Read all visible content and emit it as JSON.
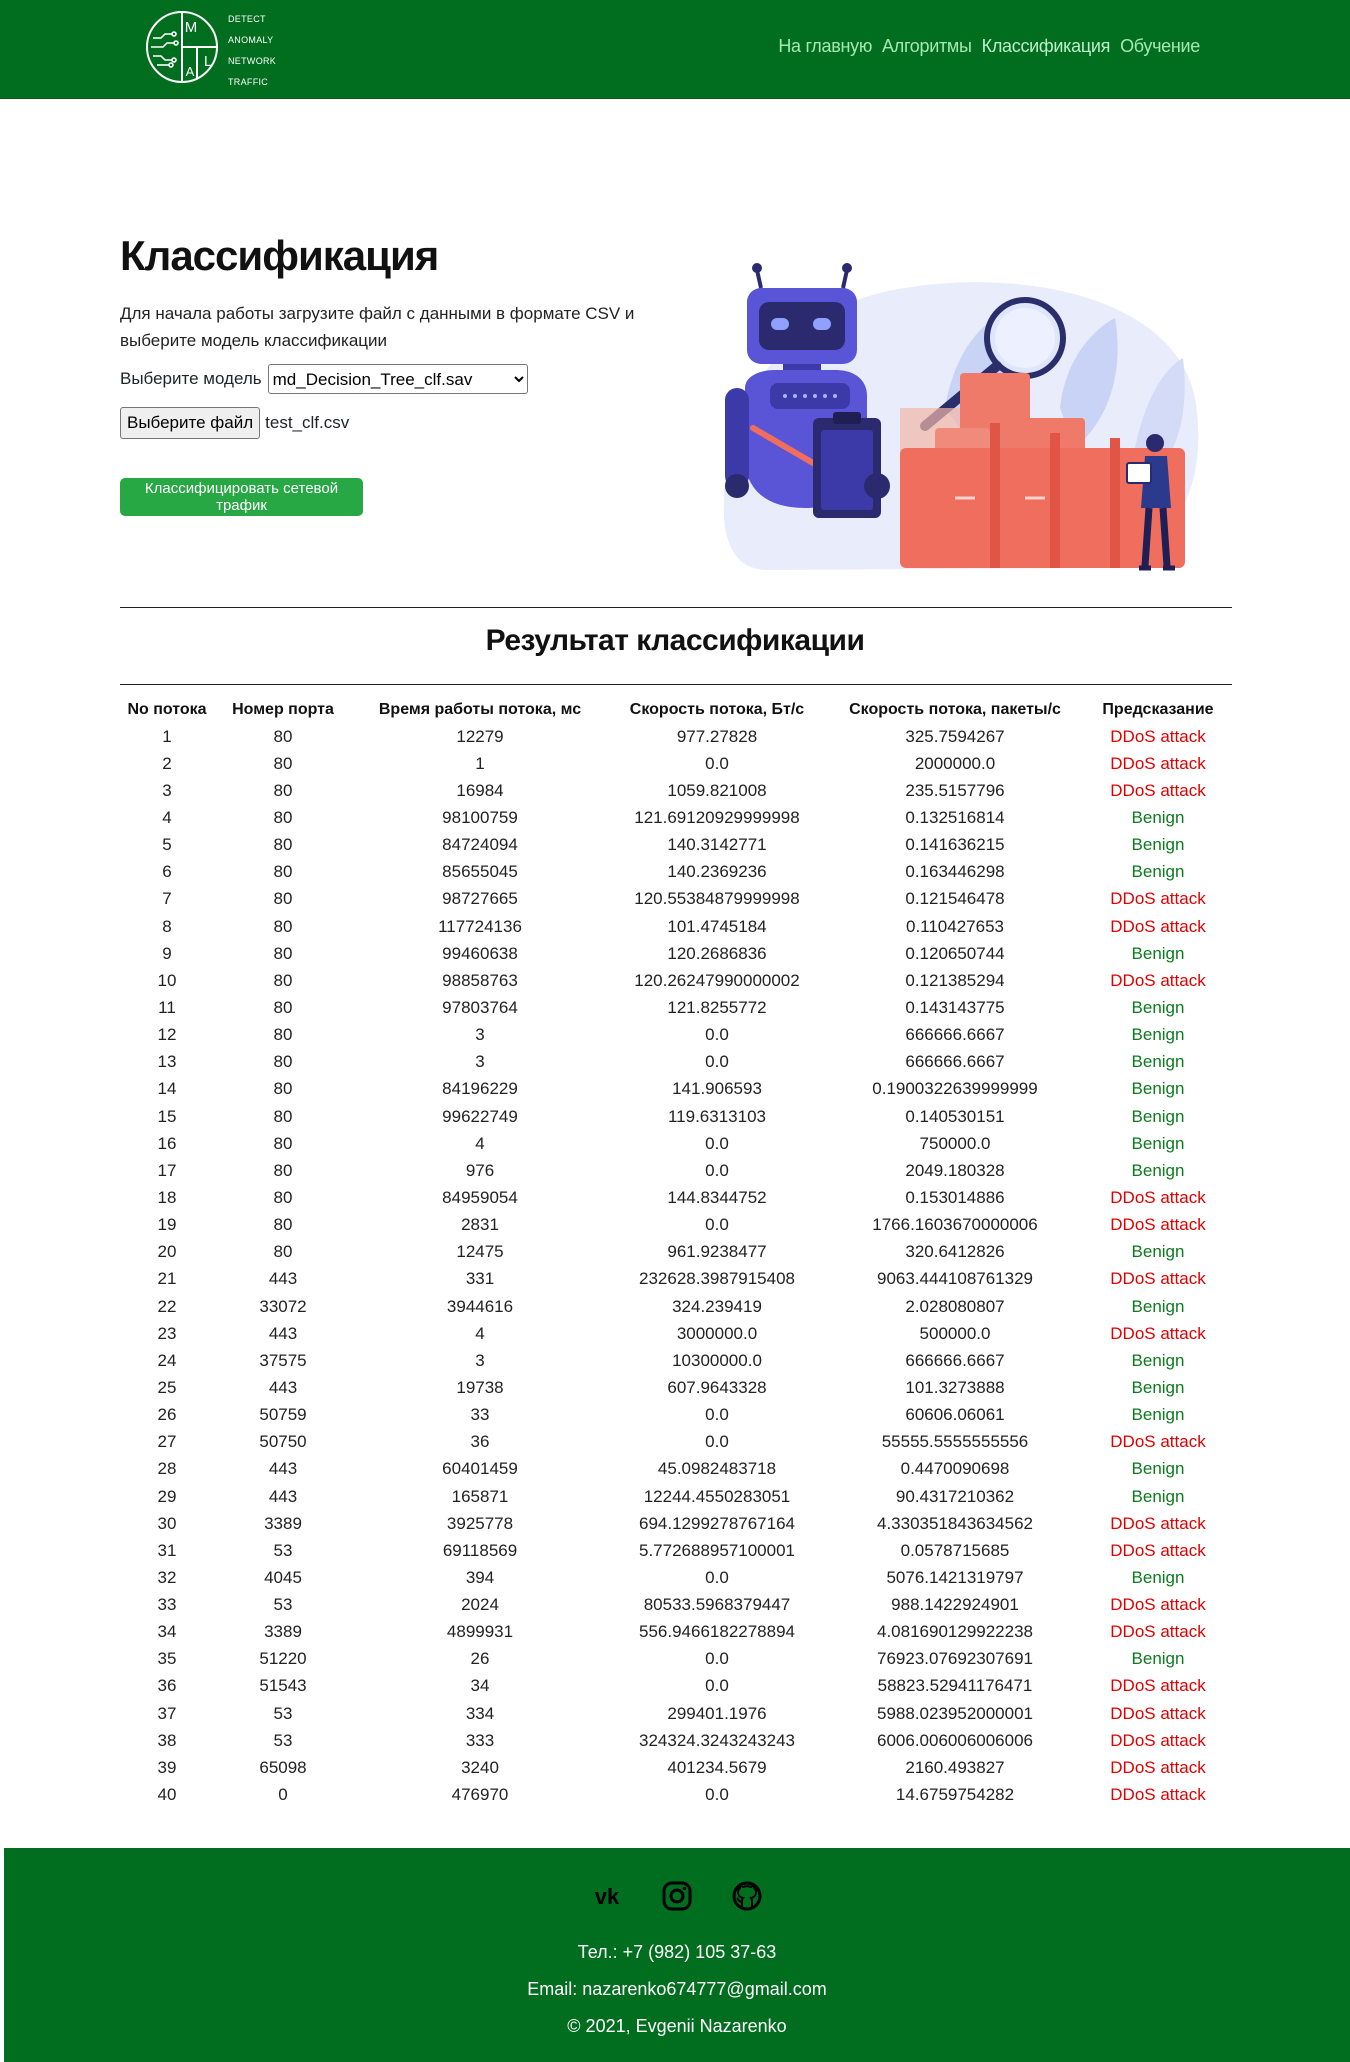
{
  "logo": {
    "letters": [
      "M",
      "L",
      "A"
    ],
    "lines": [
      "DETECT",
      "ANOMALY",
      "NETWORK",
      "TRAFFIC"
    ]
  },
  "nav": [
    {
      "label": "На главную"
    },
    {
      "label": "Алгоритмы"
    },
    {
      "label": "Классификация"
    },
    {
      "label": "Обучение"
    }
  ],
  "page": {
    "title": "Классификация",
    "description": "Для начала работы загрузите файл с данными в формате CSV и выберите модель классификации",
    "model_label": "Выберите модель",
    "model_selected": "md_Decision_Tree_clf.sav",
    "file_button": "Выберите файл",
    "file_name": "test_clf.csv",
    "classify_button": "Классифицировать сетевой трафик"
  },
  "results": {
    "title": "Результат классификации",
    "headers": [
      "No потока",
      "Номер порта",
      "Время работы потока, мс",
      "Скорость потока, Бт/с",
      "Скорость потока, пакеты/с",
      "Предсказание"
    ],
    "rows": [
      [
        "1",
        "80",
        "12279",
        "977.27828",
        "325.7594267",
        "DDoS attack"
      ],
      [
        "2",
        "80",
        "1",
        "0.0",
        "2000000.0",
        "DDoS attack"
      ],
      [
        "3",
        "80",
        "16984",
        "1059.821008",
        "235.5157796",
        "DDoS attack"
      ],
      [
        "4",
        "80",
        "98100759",
        "121.69120929999998",
        "0.132516814",
        "Benign"
      ],
      [
        "5",
        "80",
        "84724094",
        "140.3142771",
        "0.141636215",
        "Benign"
      ],
      [
        "6",
        "80",
        "85655045",
        "140.2369236",
        "0.163446298",
        "Benign"
      ],
      [
        "7",
        "80",
        "98727665",
        "120.55384879999998",
        "0.121546478",
        "DDoS attack"
      ],
      [
        "8",
        "80",
        "117724136",
        "101.4745184",
        "0.110427653",
        "DDoS attack"
      ],
      [
        "9",
        "80",
        "99460638",
        "120.2686836",
        "0.120650744",
        "Benign"
      ],
      [
        "10",
        "80",
        "98858763",
        "120.26247990000002",
        "0.121385294",
        "DDoS attack"
      ],
      [
        "11",
        "80",
        "97803764",
        "121.8255772",
        "0.143143775",
        "Benign"
      ],
      [
        "12",
        "80",
        "3",
        "0.0",
        "666666.6667",
        "Benign"
      ],
      [
        "13",
        "80",
        "3",
        "0.0",
        "666666.6667",
        "Benign"
      ],
      [
        "14",
        "80",
        "84196229",
        "141.906593",
        "0.1900322639999999",
        "Benign"
      ],
      [
        "15",
        "80",
        "99622749",
        "119.6313103",
        "0.140530151",
        "Benign"
      ],
      [
        "16",
        "80",
        "4",
        "0.0",
        "750000.0",
        "Benign"
      ],
      [
        "17",
        "80",
        "976",
        "0.0",
        "2049.180328",
        "Benign"
      ],
      [
        "18",
        "80",
        "84959054",
        "144.8344752",
        "0.153014886",
        "DDoS attack"
      ],
      [
        "19",
        "80",
        "2831",
        "0.0",
        "1766.1603670000006",
        "DDoS attack"
      ],
      [
        "20",
        "80",
        "12475",
        "961.9238477",
        "320.6412826",
        "Benign"
      ],
      [
        "21",
        "443",
        "331",
        "232628.3987915408",
        "9063.444108761329",
        "DDoS attack"
      ],
      [
        "22",
        "33072",
        "3944616",
        "324.239419",
        "2.028080807",
        "Benign"
      ],
      [
        "23",
        "443",
        "4",
        "3000000.0",
        "500000.0",
        "DDoS attack"
      ],
      [
        "24",
        "37575",
        "3",
        "10300000.0",
        "666666.6667",
        "Benign"
      ],
      [
        "25",
        "443",
        "19738",
        "607.9643328",
        "101.3273888",
        "Benign"
      ],
      [
        "26",
        "50759",
        "33",
        "0.0",
        "60606.06061",
        "Benign"
      ],
      [
        "27",
        "50750",
        "36",
        "0.0",
        "55555.5555555556",
        "DDoS attack"
      ],
      [
        "28",
        "443",
        "60401459",
        "45.0982483718",
        "0.4470090698",
        "Benign"
      ],
      [
        "29",
        "443",
        "165871",
        "12244.4550283051",
        "90.4317210362",
        "Benign"
      ],
      [
        "30",
        "3389",
        "3925778",
        "694.1299278767164",
        "4.330351843634562",
        "DDoS attack"
      ],
      [
        "31",
        "53",
        "69118569",
        "5.772688957100001",
        "0.0578715685",
        "DDoS attack"
      ],
      [
        "32",
        "4045",
        "394",
        "0.0",
        "5076.1421319797",
        "Benign"
      ],
      [
        "33",
        "53",
        "2024",
        "80533.5968379447",
        "988.1422924901",
        "DDoS attack"
      ],
      [
        "34",
        "3389",
        "4899931",
        "556.9466182278894",
        "4.081690129922238",
        "DDoS attack"
      ],
      [
        "35",
        "51220",
        "26",
        "0.0",
        "76923.07692307691",
        "Benign"
      ],
      [
        "36",
        "51543",
        "34",
        "0.0",
        "58823.52941176471",
        "DDoS attack"
      ],
      [
        "37",
        "53",
        "334",
        "299401.1976",
        "5988.023952000001",
        "DDoS attack"
      ],
      [
        "38",
        "53",
        "333",
        "324324.3243243243",
        "6006.006006006006",
        "DDoS attack"
      ],
      [
        "39",
        "65098",
        "3240",
        "401234.5679",
        "2160.493827",
        "DDoS attack"
      ],
      [
        "40",
        "0",
        "476970",
        "0.0",
        "14.6759754282",
        "DDoS attack"
      ]
    ]
  },
  "footer": {
    "socials": [
      "vk-icon",
      "instagram-icon",
      "github-icon"
    ],
    "phone": "Тел.: +7 (982) 105 37-63",
    "email": "Email: nazarenko674777@gmail.com",
    "copyright": "© 2021, Evgenii Nazarenko"
  },
  "colors": {
    "header_bg": "#006e1e",
    "footer_bg": "#006e1e",
    "button_green": "#28a745",
    "ddos_red": "#e00000",
    "benign_green": "#0d7a1e"
  }
}
